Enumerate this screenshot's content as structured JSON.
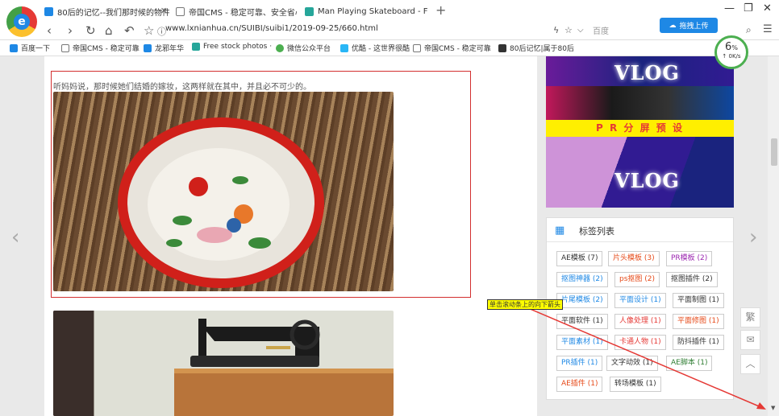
{
  "browser": {
    "tabs": [
      {
        "label": "80后的记忆--我们那时候的物件",
        "color": "#1e88e5"
      },
      {
        "label": "帝国CMS - 稳定可靠、安全省心",
        "color": "#777777"
      },
      {
        "label": "Man Playing Skateboard - Free St",
        "color": "#26a69a"
      }
    ],
    "new_tab": "+",
    "window_controls": [
      "—",
      "❐",
      "✕"
    ],
    "url": "www.lxnianhua.cn/SUIBI/suibi1/2019-09-25/660.html",
    "engine": "百度",
    "upload_label": "拖拽上传",
    "gauge": {
      "percent": "6",
      "unit": "%",
      "speed": "↑ 0K/s"
    }
  },
  "bookmarks": [
    {
      "label": "百度一下",
      "color": "#1e88e5"
    },
    {
      "label": "帝国CMS - 稳定可靠",
      "color": "#777777"
    },
    {
      "label": "龙邪年华",
      "color": "#1e88e5"
    },
    {
      "label": "Free stock photos ·",
      "color": "#26a69a"
    },
    {
      "label": "微信公众平台",
      "color": "#4caf50"
    },
    {
      "label": "优酷 - 这世界很酷",
      "color": "#29b6f6"
    },
    {
      "label": "帝国CMS - 稳定可靠",
      "color": "#777777"
    },
    {
      "label": "80后记忆|属于80后",
      "color": "#333333"
    }
  ],
  "article": {
    "caption": "听妈妈说，那时候她们结婚的嫁妆，这两样就在其中，并且必不可少的。"
  },
  "sidebar": {
    "banner_text": "VLOG",
    "banner_text2": "VLOG",
    "pr_banner": "P R 分 屏 预 设",
    "tags_title": "标签列表",
    "tags": [
      {
        "label": "AE模板 (7)",
        "color": "#333333"
      },
      {
        "label": "片头模板 (3)",
        "color": "#e64a19"
      },
      {
        "label": "PR模板 (2)",
        "color": "#9c27b0"
      },
      {
        "label": "抠图神器 (2)",
        "color": "#1e88e5"
      },
      {
        "label": "ps抠图 (2)",
        "color": "#e64a19"
      },
      {
        "label": "抠图插件 (2)",
        "color": "#333333"
      },
      {
        "label": "片尾模板 (2)",
        "color": "#1e88e5"
      },
      {
        "label": "平面设计 (1)",
        "color": "#1e88e5"
      },
      {
        "label": "平面制图 (1)",
        "color": "#333333"
      },
      {
        "label": "平面软件 (1)",
        "color": "#333333"
      },
      {
        "label": "人像处理 (1)",
        "color": "#e53935"
      },
      {
        "label": "平面修图 (1)",
        "color": "#e64a19"
      },
      {
        "label": "平面素材 (1)",
        "color": "#1e88e5"
      },
      {
        "label": "卡通人物 (1)",
        "color": "#e53935"
      },
      {
        "label": "防抖插件 (1)",
        "color": "#333333"
      },
      {
        "label": "PR插件 (1)",
        "color": "#1e88e5"
      },
      {
        "label": "文字动效 (1)",
        "color": "#333333"
      },
      {
        "label": "AE脚本 (1)",
        "color": "#2e7d32"
      },
      {
        "label": "AE插件 (1)",
        "color": "#e64a19"
      },
      {
        "label": "转场模板 (1)",
        "color": "#333333"
      }
    ]
  },
  "float_buttons": {
    "traditional": "繁",
    "wechat_icon": "wechat-icon",
    "top_icon": "arrow-up-icon"
  },
  "tooltip": "单击滚动条上的向下箭头"
}
